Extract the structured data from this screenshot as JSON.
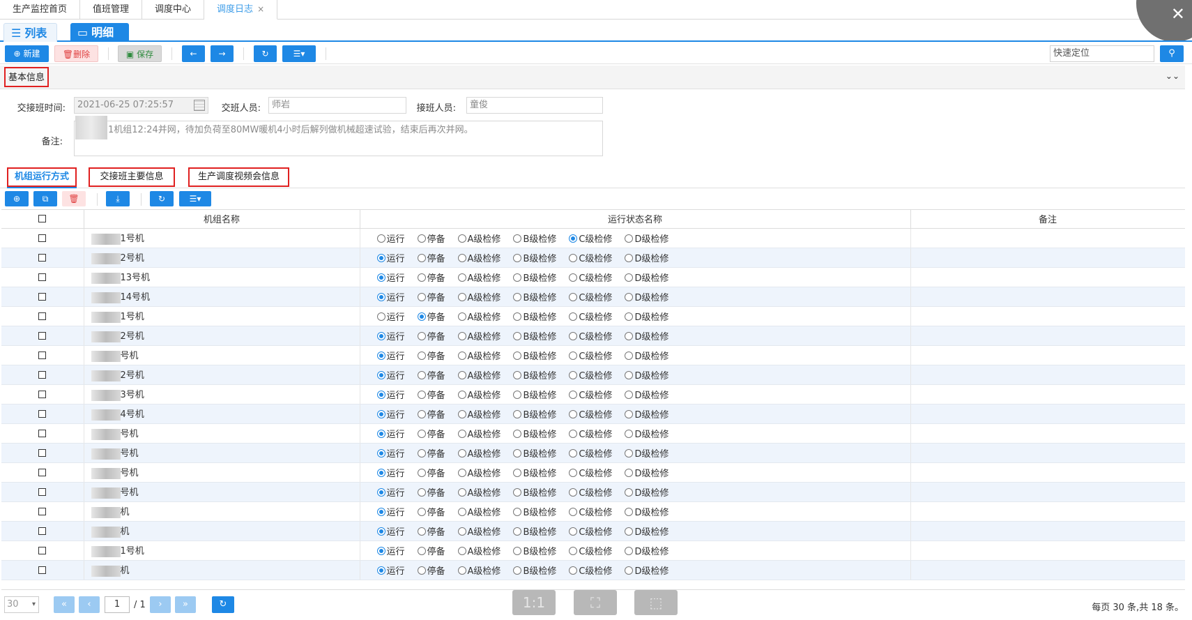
{
  "top_tabs": [
    {
      "label": "生产监控首页"
    },
    {
      "label": "值班管理"
    },
    {
      "label": "调度中心"
    },
    {
      "label": "调度日志",
      "close": "×"
    }
  ],
  "corner_close": "✕",
  "view_modes": {
    "list_label": "列表",
    "detail_label": "明细"
  },
  "toolbar": {
    "new_label": "新建",
    "delete_label": "删除",
    "save_label": "保存",
    "quick_locate": "快速定位"
  },
  "basic_info": {
    "title": "基本信息",
    "handover_time_label": "交接班时间:",
    "handover_time_value": "2021-06-25 07:25:57",
    "handover_person_label": "交班人员:",
    "handover_person_value": "师岩",
    "takeover_person_label": "接班人员:",
    "takeover_person_value": "童俊",
    "remark_label": "备注:",
    "remark_value": "1机组12:24并网，待加负荷至80MW暖机4小时后解列做机械超速试验，结束后再次并网。"
  },
  "sub_tabs": [
    {
      "label": "机组运行方式"
    },
    {
      "label": "交接班主要信息"
    },
    {
      "label": "生产调度视频会信息"
    }
  ],
  "table": {
    "headers": [
      "机组名称",
      "运行状态名称",
      "备注"
    ],
    "status_options": [
      "运行",
      "停备",
      "A级检修",
      "B级检修",
      "C级检修",
      "D级检修"
    ],
    "rows": [
      {
        "name": "1号机",
        "status": "C级检修"
      },
      {
        "name": "2号机",
        "status": "运行"
      },
      {
        "name": "13号机",
        "status": "运行"
      },
      {
        "name": "14号机",
        "status": "运行"
      },
      {
        "name": "1号机",
        "status": "停备"
      },
      {
        "name": "2号机",
        "status": "运行"
      },
      {
        "name": "号机",
        "status": "运行"
      },
      {
        "name": "2号机",
        "status": "运行"
      },
      {
        "name": "3号机",
        "status": "运行"
      },
      {
        "name": "4号机",
        "status": "运行"
      },
      {
        "name": "号机",
        "status": "运行"
      },
      {
        "name": "号机",
        "status": "运行"
      },
      {
        "name": "号机",
        "status": "运行"
      },
      {
        "name": "号机",
        "status": "运行"
      },
      {
        "name": "机",
        "status": "运行"
      },
      {
        "name": "机",
        "status": "运行"
      },
      {
        "name": "1号机",
        "status": "运行"
      },
      {
        "name": "机",
        "status": "运行"
      }
    ]
  },
  "pager": {
    "page_size": "30",
    "page": "1",
    "total_pages": "/ 1",
    "info": "每页 30 条,共 18 条。",
    "view_fit_label": "1:1"
  }
}
